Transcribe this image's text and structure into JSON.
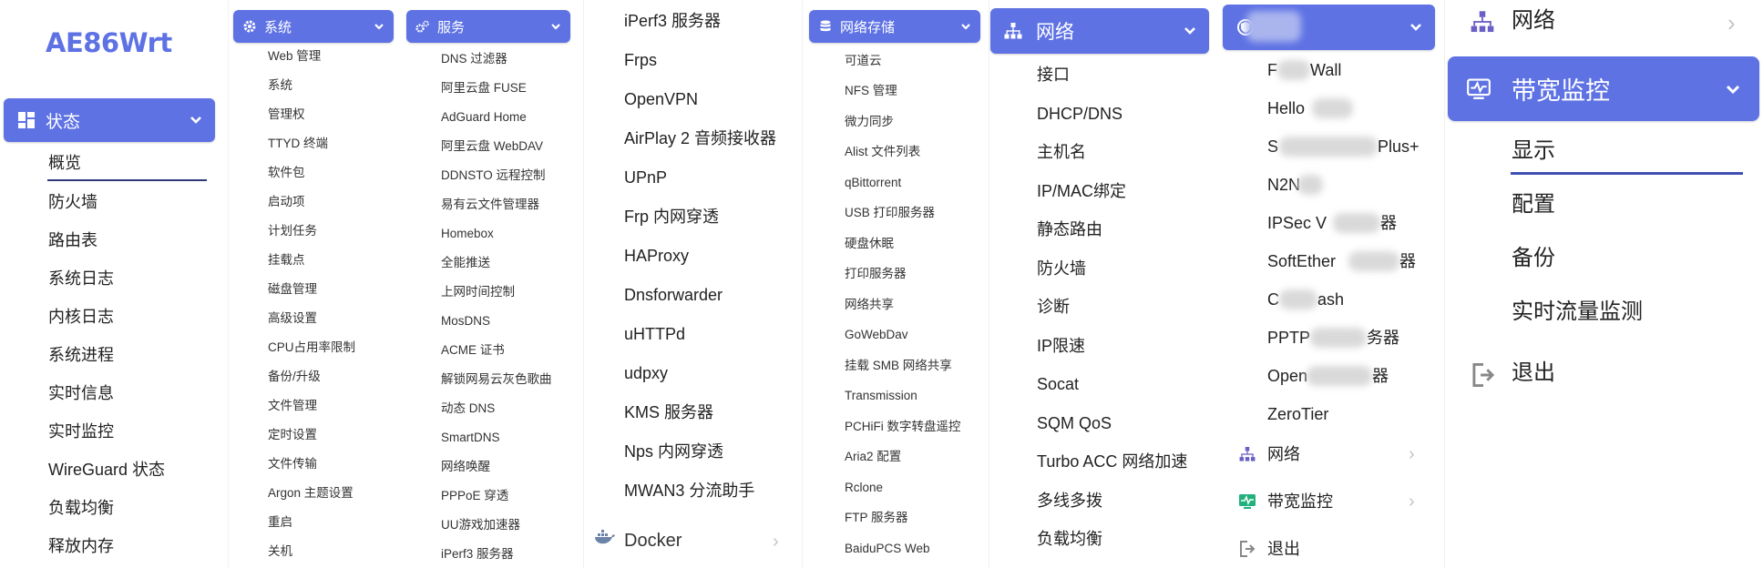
{
  "brand": {
    "logo": "AE86Wrt",
    "accent": "#5e72e4"
  },
  "col1": {
    "header": "状态",
    "items": [
      "概览",
      "防火墙",
      "路由表",
      "系统日志",
      "内核日志",
      "系统进程",
      "实时信息",
      "实时监控",
      "WireGuard 状态",
      "负载均衡",
      "释放内存"
    ]
  },
  "col2": {
    "header": "系统",
    "items": [
      "Web 管理",
      "系统",
      "管理权",
      "TTYD 终端",
      "软件包",
      "启动项",
      "计划任务",
      "挂载点",
      "磁盘管理",
      "高级设置",
      "CPU占用率限制",
      "备份/升级",
      "文件管理",
      "定时设置",
      "文件传输",
      "Argon 主题设置",
      "重启",
      "关机"
    ]
  },
  "col3": {
    "header": "服务",
    "items": [
      "DNS 过滤器",
      "阿里云盘 FUSE",
      "AdGuard Home",
      "阿里云盘 WebDAV",
      "DDNSTO 远程控制",
      "易有云文件管理器",
      "Homebox",
      "全能推送",
      "上网时间控制",
      "MosDNS",
      "ACME 证书",
      "解锁网易云灰色歌曲",
      "动态 DNS",
      "SmartDNS",
      "网络唤醒",
      "PPPoE 穿透",
      "UU游戏加速器",
      "iPerf3 服务器"
    ]
  },
  "col4": {
    "items": [
      "iPerf3 服务器",
      "Frps",
      "OpenVPN",
      "AirPlay 2 音频接收器",
      "UPnP",
      "Frp 内网穿透",
      "HAProxy",
      "Dnsforwarder",
      "uHTTPd",
      "udpxy",
      "KMS 服务器",
      "Nps 内网穿透",
      "MWAN3 分流助手"
    ],
    "docker": "Docker"
  },
  "col5": {
    "header": "网络存储",
    "items": [
      "可道云",
      "NFS 管理",
      "微力同步",
      "Alist 文件列表",
      "qBittorrent",
      "USB 打印服务器",
      "硬盘休眠",
      "打印服务器",
      "网络共享",
      "GoWebDav",
      "挂载 SMB 网络共享",
      "Transmission",
      "PCHiFi 数字转盘遥控",
      "Aria2 配置",
      "Rclone",
      "FTP 服务器",
      "BaiduPCS Web"
    ]
  },
  "col6": {
    "header": "网络",
    "items": [
      "接口",
      "DHCP/DNS",
      "主机名",
      "IP/MAC绑定",
      "静态路由",
      "防火墙",
      "诊断",
      "IP限速",
      "Socat",
      "SQM QoS",
      "Turbo ACC 网络加速",
      "多线多拨",
      "负载均衡"
    ]
  },
  "col7": {
    "header": "V",
    "items": [
      "F",
      "Wall",
      "Hello",
      "S",
      "Plus+",
      "N2N",
      "IPSec V",
      "器",
      "SoftEther",
      "器",
      "C",
      "ash",
      "PPTP",
      "务器",
      "Open",
      "器",
      "ZeroTier"
    ],
    "nav_network": "网络",
    "nav_bandwidth": "带宽监控",
    "nav_logout": "退出"
  },
  "col8": {
    "network": "网络",
    "header": "带宽监控",
    "items": [
      "显示",
      "配置",
      "备份",
      "实时流量监测"
    ],
    "logout": "退出"
  },
  "icons": {
    "col1_header": "dashboard-icon",
    "col2_header": "gear-icon",
    "col3_header": "cogs-icon",
    "col5_header": "database-icon",
    "col6_header": "sitemap-icon",
    "col7_header": "shield-icon",
    "network": "sitemap-icon",
    "bandwidth": "monitor-icon",
    "logout": "sign-out-icon",
    "docker": "docker-icon"
  }
}
